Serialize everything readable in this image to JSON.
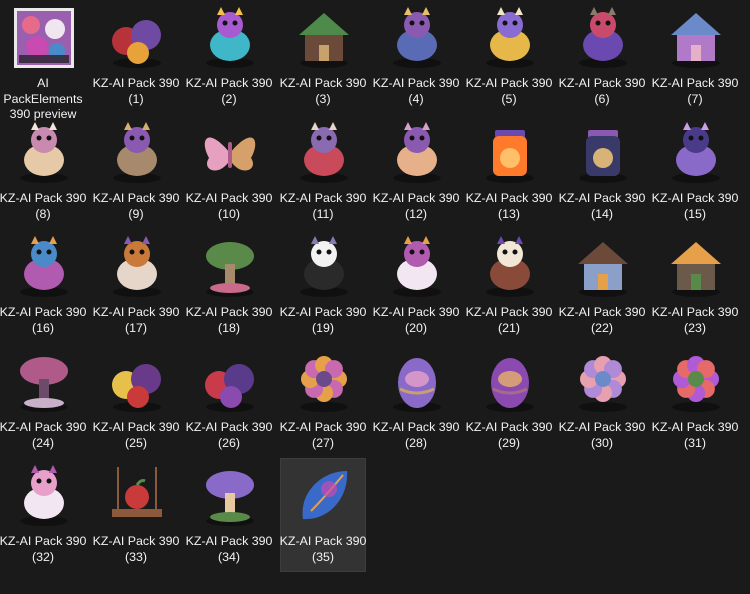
{
  "view": {
    "background": "#1a1a1a",
    "selected_background": "#333333",
    "text_color": "#f2f2f2"
  },
  "items": [
    {
      "label": "AI PackElements 390 preview",
      "icon": "collage-preview-icon",
      "colors": [
        "#f0e6f0",
        "#9b5fb0",
        "#e66b8a"
      ],
      "selected": false
    },
    {
      "label": "KZ-AI Pack 390 (1)",
      "icon": "birds-on-fruit-basket-icon",
      "colors": [
        "#b8323a",
        "#6f4aa3",
        "#e8a23a"
      ],
      "selected": false
    },
    {
      "label": "KZ-AI Pack 390 (2)",
      "icon": "frog-icon",
      "colors": [
        "#3fb7c9",
        "#a85ad1",
        "#f2c14e"
      ],
      "selected": false
    },
    {
      "label": "KZ-AI Pack 390 (3)",
      "icon": "treehouse-icon",
      "colors": [
        "#6b4a3a",
        "#4e8a4a",
        "#c9a26b"
      ],
      "selected": false
    },
    {
      "label": "KZ-AI Pack 390 (4)",
      "icon": "cow-icon",
      "colors": [
        "#5a6bb5",
        "#8a5ab0",
        "#e6c06b"
      ],
      "selected": false
    },
    {
      "label": "KZ-AI Pack 390 (5)",
      "icon": "chick-icon",
      "colors": [
        "#e6b84a",
        "#8a6bd1",
        "#f0e6c9"
      ],
      "selected": false
    },
    {
      "label": "KZ-AI Pack 390 (6)",
      "icon": "bird-on-stump-icon",
      "colors": [
        "#6a4ab0",
        "#c94a6b",
        "#8a7a6a"
      ],
      "selected": false
    },
    {
      "label": "KZ-AI Pack 390 (7)",
      "icon": "stone-wall-icon",
      "colors": [
        "#b07ac9",
        "#6a8ac9",
        "#e6b0c9"
      ],
      "selected": false
    },
    {
      "label": "KZ-AI Pack 390 (8)",
      "icon": "winged-bunny-icon",
      "colors": [
        "#e6c9a6",
        "#c98ab0",
        "#f2e6d6"
      ],
      "selected": false
    },
    {
      "label": "KZ-AI Pack 390 (9)",
      "icon": "fairy-bunny-icon",
      "colors": [
        "#a68a6b",
        "#8a5ab0",
        "#d6b06b"
      ],
      "selected": false
    },
    {
      "label": "KZ-AI Pack 390 (10)",
      "icon": "butterfly-icon",
      "colors": [
        "#e6a0c0",
        "#d6a06b",
        "#b05a8a"
      ],
      "selected": false
    },
    {
      "label": "KZ-AI Pack 390 (11)",
      "icon": "gnome-icon",
      "colors": [
        "#c94a5a",
        "#8a6ab0",
        "#e6d6c9"
      ],
      "selected": false
    },
    {
      "label": "KZ-AI Pack 390 (12)",
      "icon": "fairy-girl-icon",
      "colors": [
        "#e6b08a",
        "#8a5ab0",
        "#d6a0c9"
      ],
      "selected": false
    },
    {
      "label": "KZ-AI Pack 390 (13)",
      "icon": "glowing-jar-icon",
      "colors": [
        "#ff7a2a",
        "#c93a3a",
        "#6a4ab0"
      ],
      "selected": false
    },
    {
      "label": "KZ-AI Pack 390 (14)",
      "icon": "lantern-icon",
      "colors": [
        "#3a3a6a",
        "#e68a3a",
        "#8a5ab0"
      ],
      "selected": false
    },
    {
      "label": "KZ-AI Pack 390 (15)",
      "icon": "lizard-icon",
      "colors": [
        "#8a6ac9",
        "#4a3a8a",
        "#c9a0e6"
      ],
      "selected": false
    },
    {
      "label": "KZ-AI Pack 390 (16)",
      "icon": "cat-icon",
      "colors": [
        "#b05ab0",
        "#4a8ac9",
        "#e6a04a"
      ],
      "selected": false
    },
    {
      "label": "KZ-AI Pack 390 (17)",
      "icon": "fox-icon",
      "colors": [
        "#e6d6c9",
        "#c97a3a",
        "#8a5ab0"
      ],
      "selected": false
    },
    {
      "label": "KZ-AI Pack 390 (18)",
      "icon": "garden-fountain-icon",
      "colors": [
        "#5a8a4a",
        "#a68a6b",
        "#c96a8a"
      ],
      "selected": false
    },
    {
      "label": "KZ-AI Pack 390 (19)",
      "icon": "chickadee-icon",
      "colors": [
        "#2a2a2a",
        "#f2f2f2",
        "#8a7ab0"
      ],
      "selected": false
    },
    {
      "label": "KZ-AI Pack 390 (20)",
      "icon": "unicorn-icon",
      "colors": [
        "#f2e6f2",
        "#b05ab0",
        "#e6a04a"
      ],
      "selected": false
    },
    {
      "label": "KZ-AI Pack 390 (21)",
      "icon": "spaniel-dog-icon",
      "colors": [
        "#8a4a3a",
        "#f2e6d6",
        "#6a4ab0"
      ],
      "selected": false
    },
    {
      "label": "KZ-AI Pack 390 (22)",
      "icon": "cottage-icon",
      "colors": [
        "#8aa0c9",
        "#6b4a3a",
        "#e6a04a"
      ],
      "selected": false
    },
    {
      "label": "KZ-AI Pack 390 (23)",
      "icon": "stone-house-icon",
      "colors": [
        "#6b5a4a",
        "#e6a04a",
        "#5a8a4a"
      ],
      "selected": false
    },
    {
      "label": "KZ-AI Pack 390 (24)",
      "icon": "bonsai-tree-icon",
      "colors": [
        "#b05a8a",
        "#6b4a6a",
        "#c9b0c9"
      ],
      "selected": false
    },
    {
      "label": "KZ-AI Pack 390 (25)",
      "icon": "fruit-pile-icon",
      "colors": [
        "#e6c04a",
        "#6a3a8a",
        "#c93a3a"
      ],
      "selected": false
    },
    {
      "label": "KZ-AI Pack 390 (26)",
      "icon": "berries-icon",
      "colors": [
        "#c93a4a",
        "#5a3a8a",
        "#8a4ab0"
      ],
      "selected": false
    },
    {
      "label": "KZ-AI Pack 390 (27)",
      "icon": "flower-icon",
      "colors": [
        "#c96ab0",
        "#e6a04a",
        "#6a4a8a"
      ],
      "selected": false
    },
    {
      "label": "KZ-AI Pack 390 (28)",
      "icon": "easter-egg-icon",
      "colors": [
        "#8a6ac9",
        "#e6a0c9",
        "#c9a06b"
      ],
      "selected": false
    },
    {
      "label": "KZ-AI Pack 390 (29)",
      "icon": "egg-with-candle-icon",
      "colors": [
        "#8a4ab0",
        "#e6b06b",
        "#a66b8a"
      ],
      "selected": false
    },
    {
      "label": "KZ-AI Pack 390 (30)",
      "icon": "hydrangea-icon",
      "colors": [
        "#b08ad6",
        "#e6a0b0",
        "#6a8ac9"
      ],
      "selected": false
    },
    {
      "label": "KZ-AI Pack 390 (31)",
      "icon": "tulips-icon",
      "colors": [
        "#e66a6a",
        "#b05ad6",
        "#5a8a4a"
      ],
      "selected": false
    },
    {
      "label": "KZ-AI Pack 390 (32)",
      "icon": "unicorn-head-icon",
      "colors": [
        "#f2e6f2",
        "#e6a0c9",
        "#b05ab0"
      ],
      "selected": false
    },
    {
      "label": "KZ-AI Pack 390 (33)",
      "icon": "apple-swing-icon",
      "colors": [
        "#c93a3a",
        "#8a5a3a",
        "#5a8a4a"
      ],
      "selected": false
    },
    {
      "label": "KZ-AI Pack 390 (34)",
      "icon": "mushroom-icon",
      "colors": [
        "#8a6ac9",
        "#e6c9a0",
        "#5a8a4a"
      ],
      "selected": false
    },
    {
      "label": "KZ-AI Pack 390 (35)",
      "icon": "leaf-icon",
      "colors": [
        "#3a6ac9",
        "#c94ab0",
        "#e6a04a"
      ],
      "selected": true
    }
  ]
}
